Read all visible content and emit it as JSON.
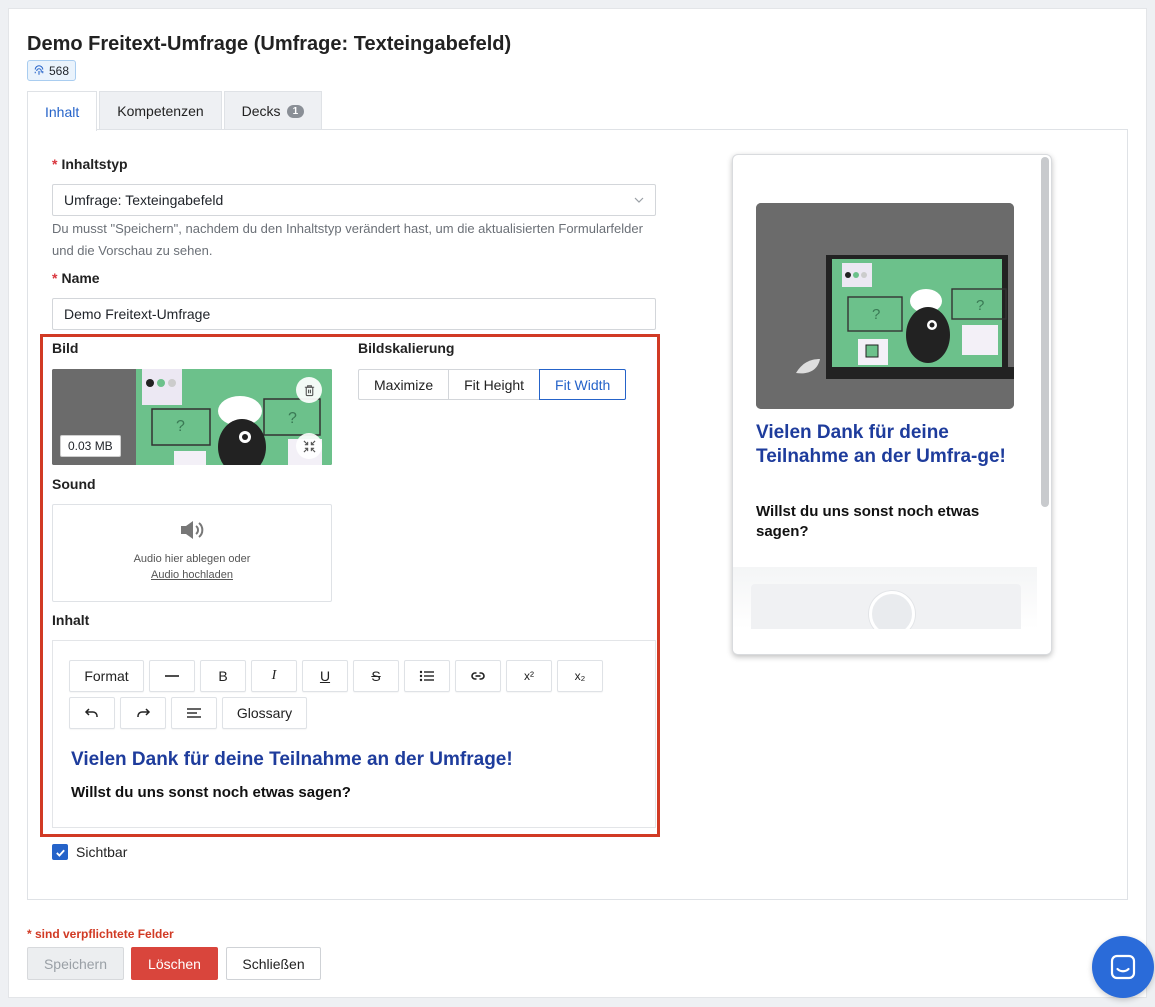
{
  "header": {
    "title": "Demo Freitext-Umfrage (Umfrage: Texteingabefeld)",
    "id_badge": "568"
  },
  "tabs": [
    {
      "label": "Inhalt",
      "active": true
    },
    {
      "label": "Kompetenzen"
    },
    {
      "label": "Decks",
      "count": "1"
    }
  ],
  "form": {
    "content_type": {
      "required_mark": "*",
      "label": "Inhaltstyp",
      "value": "Umfrage: Texteingabefeld",
      "help": "Du musst \"Speichern\", nachdem du den Inhaltstyp verändert hast, um die aktualisierten Formularfelder und die Vorschau zu sehen."
    },
    "name": {
      "required_mark": "*",
      "label": "Name",
      "value": "Demo Freitext-Umfrage"
    },
    "image": {
      "label": "Bild",
      "size": "0.03 MB"
    },
    "scaling": {
      "label": "Bildskalierung",
      "options": [
        "Maximize",
        "Fit Height",
        "Fit Width"
      ],
      "selected": "Fit Width"
    },
    "sound": {
      "label": "Sound",
      "drop_text": "Audio hier ablegen oder",
      "upload_link": "Audio hochladen"
    },
    "content": {
      "label": "Inhalt",
      "toolbar": {
        "format": "Format",
        "bold": "B",
        "italic": "I",
        "underline": "U",
        "strike": "S",
        "superscript": "x²",
        "subscript": "x₂",
        "glossary": "Glossary"
      },
      "heading": "Vielen Dank für deine Teilnahme an der Umfrage!",
      "paragraph": "Willst du uns sonst noch etwas sagen?"
    },
    "visible": {
      "label": "Sichtbar",
      "checked": true
    }
  },
  "preview": {
    "heading": "Vielen Dank für deine Teilnahme an der Umfra-ge!",
    "paragraph": "Willst du uns sonst noch etwas sagen?"
  },
  "footer": {
    "required_note": "* sind verpflichtete Felder",
    "save": "Speichern",
    "delete": "Löschen",
    "close": "Schließen"
  },
  "colors": {
    "accent": "#2563c9",
    "danger": "#d9453c",
    "highlight": "#d13a24",
    "heading": "#1e3c9c",
    "illustration_green": "#6cc18b"
  }
}
